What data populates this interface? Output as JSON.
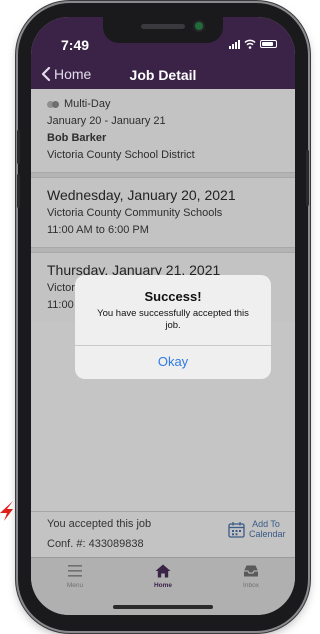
{
  "status_bar": {
    "time": "7:49"
  },
  "nav": {
    "back_label": "Home",
    "title": "Job Detail"
  },
  "summary": {
    "tag": "Multi-Day",
    "date_range": "January 20 - January 21",
    "person": "Bob Barker",
    "district": "Victoria County School District"
  },
  "days": [
    {
      "date": "Wednesday, January 20, 2021",
      "location": "Victoria County Community Schools",
      "time": "11:00 AM to 6:00 PM"
    },
    {
      "date": "Thursday, January 21, 2021",
      "location": "Victor",
      "time": "11:00"
    }
  ],
  "dialog": {
    "title": "Success!",
    "message": "You have successfully accepted this job.",
    "button": "Okay"
  },
  "footer": {
    "accepted": "You accepted this job",
    "confirmation": "Conf. #: 433089838",
    "add_to_calendar": "Add To Calendar"
  },
  "tabs": [
    {
      "label": "Menu",
      "icon": "menu-icon"
    },
    {
      "label": "Home",
      "icon": "home-icon"
    },
    {
      "label": "Inbox",
      "icon": "inbox-icon"
    }
  ],
  "colors": {
    "header": "#3b2347",
    "accent_link": "#2f7ae5",
    "screen_dim": "#c5c5c5"
  }
}
